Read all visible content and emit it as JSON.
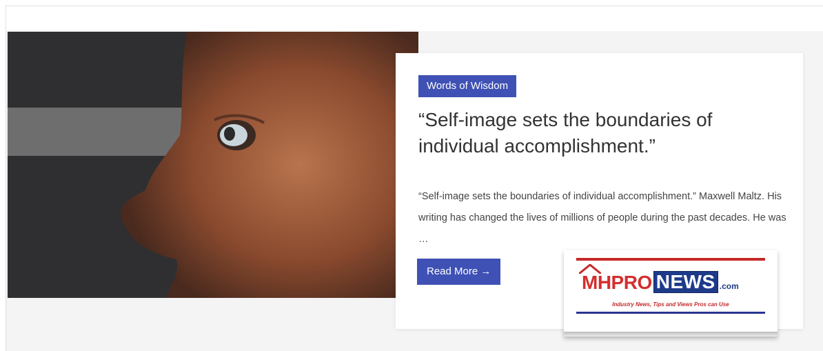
{
  "post": {
    "category": "Words of Wisdom",
    "title": "“Self-image sets the boundaries of individual accomplishment.”",
    "excerpt": "“Self-image sets the boundaries of individual accomplishment.” Maxwell Maltz. His writing has changed the lives of millions of people during the past decades. He was …",
    "read_more_label": "Read More →"
  },
  "logo": {
    "brand_part1": "MHPRO",
    "brand_part2": "NEWS",
    "brand_suffix": ".com",
    "tagline": "Industry News, Tips and Views Pros can Use"
  },
  "colors": {
    "accent": "#3f51b5",
    "logo_red": "#c62828",
    "logo_blue": "#1e3a8a"
  }
}
